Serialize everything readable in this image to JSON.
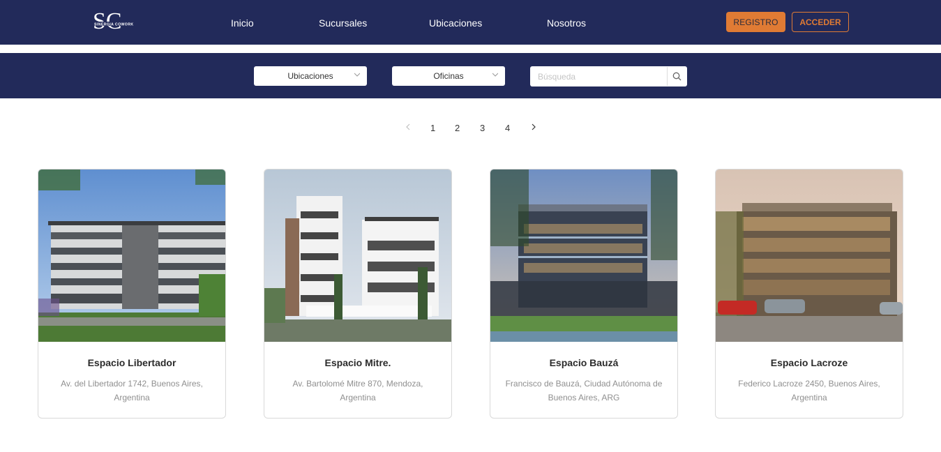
{
  "brand": {
    "logo_letters": "SC",
    "logo_subtext": "SINERGIA COWORK"
  },
  "nav": {
    "links": [
      "Inicio",
      "Sucursales",
      "Ubicaciones",
      "Nosotros"
    ],
    "registro_label": "REGISTRO",
    "acceder_label": "ACCEDER"
  },
  "filters": {
    "ubicaciones_label": "Ubicaciones",
    "oficinas_label": "Oficinas",
    "search_placeholder": "Búsqueda"
  },
  "pagination": {
    "pages": [
      "1",
      "2",
      "3",
      "4"
    ]
  },
  "cards": [
    {
      "title": "Espacio Libertador",
      "address": "Av. del Libertador 1742, Buenos Aires, Argentina"
    },
    {
      "title": "Espacio Mitre.",
      "address": "Av. Bartolomé Mitre 870, Mendoza, Argentina"
    },
    {
      "title": "Espacio Bauzá",
      "address": "Francisco de Bauzá, Ciudad Autónoma de Buenos Aires, ARG"
    },
    {
      "title": "Espacio Lacroze",
      "address": "Federico Lacroze 2450, Buenos Aires, Argentina"
    }
  ],
  "colors": {
    "navy": "#222a5a",
    "accent": "#e07b34"
  },
  "icons": {
    "search": "search-icon",
    "chevron_down": "chevron-down-icon",
    "prev": "chevron-left-icon",
    "next": "chevron-right-icon"
  }
}
